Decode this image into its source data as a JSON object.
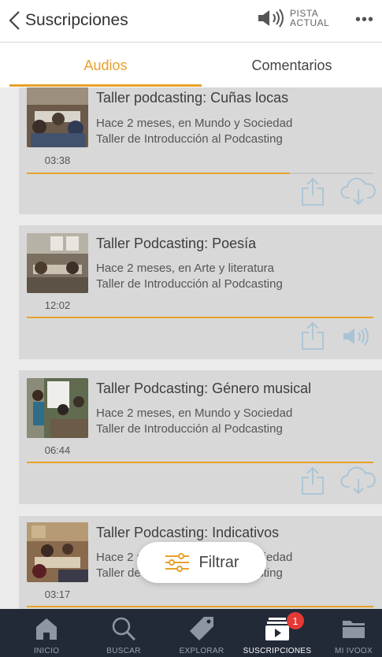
{
  "header": {
    "back_label": "Suscripciones",
    "pista_line1": "PISTA",
    "pista_line2": "ACTUAL",
    "more_label": "•••"
  },
  "tabs": [
    {
      "label": "Audios",
      "active": true
    },
    {
      "label": "Comentarios",
      "active": false
    }
  ],
  "episodes": [
    {
      "title": "Taller podcasting: Cuñas locas",
      "meta": "Hace 2 meses, en Mundo y Sociedad",
      "program": "Taller de Introducción al Podcasting",
      "duration": "03:38",
      "progress": 0.76,
      "action": "download-cloud-icon"
    },
    {
      "title": "Taller Podcasting: Poesía",
      "meta": "Hace 2 meses, en Arte y literatura",
      "program": "Taller de Introducción al Podcasting",
      "duration": "12:02",
      "progress": 1.0,
      "action": "speaker-icon"
    },
    {
      "title": "Taller Podcasting: Género musical",
      "meta": "Hace 2 meses, en Mundo y Sociedad",
      "program": "Taller de Introducción al Podcasting",
      "duration": "06:44",
      "progress": 1.0,
      "action": "download-cloud-icon"
    },
    {
      "title": "Taller Podcasting: Indicativos",
      "meta": "Hace 2 meses, en Mundo y Sociedad",
      "program": "Taller de Introducción al Podcasting",
      "duration": "03:17",
      "progress": 1.0,
      "action": "download-cloud-icon"
    }
  ],
  "filter": {
    "label": "Filtrar"
  },
  "nav": [
    {
      "label": "INICIO",
      "icon": "home-icon"
    },
    {
      "label": "BUSCAR",
      "icon": "search-icon"
    },
    {
      "label": "EXPLORAR",
      "icon": "tag-icon"
    },
    {
      "label": "SUSCRIPCIONES",
      "icon": "subscriptions-icon",
      "badge": "1",
      "active": true
    },
    {
      "label": "MI IVOOX",
      "icon": "folder-icon"
    }
  ],
  "colors": {
    "accent": "#e8a128",
    "nav_bg": "#222a38",
    "card_bg": "#d8d8d8",
    "icon_blue": "#a8c4d6",
    "badge": "#e53935"
  }
}
